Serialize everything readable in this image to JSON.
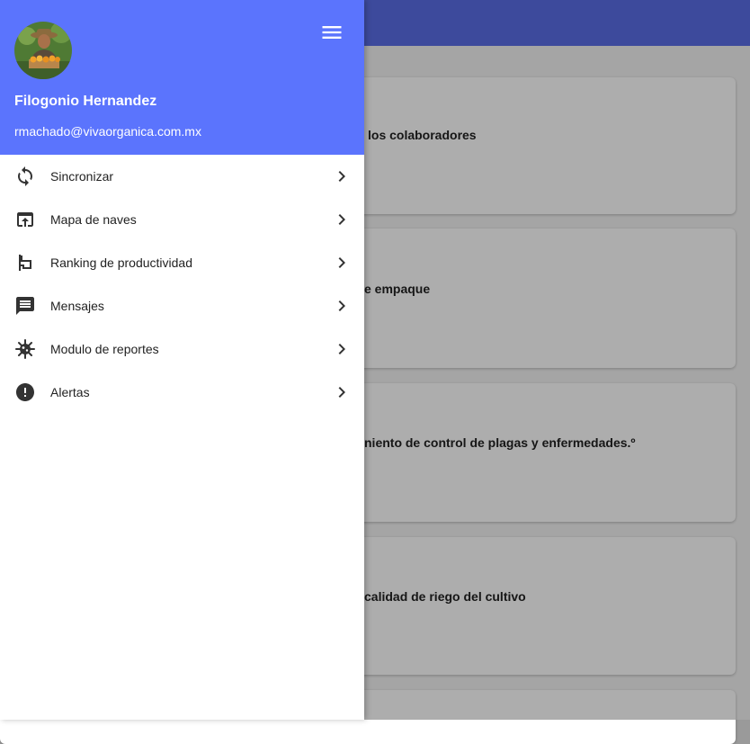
{
  "app_bar": {},
  "cards": [
    {
      "title": "los colaboradores"
    },
    {
      "title": "e empaque"
    },
    {
      "title": "niento de control de plagas y enfermedades.º"
    },
    {
      "title": "calidad de riego del cultivo"
    }
  ],
  "drawer": {
    "user": {
      "name": "Filogonio Hernandez",
      "email": "rmachado@vivaorganica.com.mx"
    },
    "items": [
      {
        "label": "Sincronizar",
        "icon": "sync-icon"
      },
      {
        "label": "Mapa de naves",
        "icon": "open-in-browser-icon"
      },
      {
        "label": "Ranking de productividad",
        "icon": "flag-icon"
      },
      {
        "label": "Mensajes",
        "icon": "message-icon"
      },
      {
        "label": "Modulo de reportes",
        "icon": "virus-icon"
      },
      {
        "label": "Alertas",
        "icon": "alert-circle-icon"
      }
    ]
  },
  "colors": {
    "header_bg": "#5b74fd",
    "app_bar_bg": "#5b6ee6",
    "icon": "#333333"
  }
}
